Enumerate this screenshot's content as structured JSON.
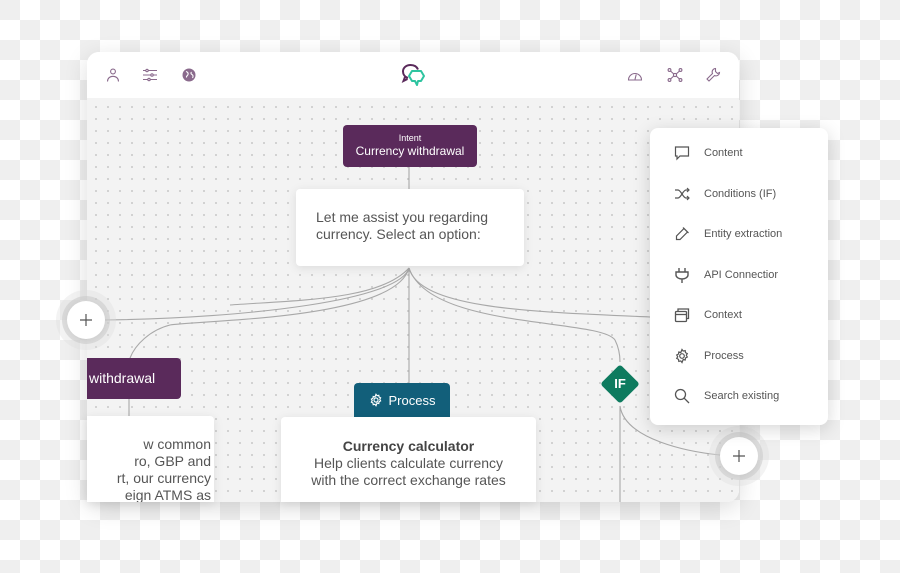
{
  "toolbar": {
    "left_icons": [
      "user-icon",
      "sliders-icon",
      "globe-icon"
    ],
    "logo": "chat-bubbles-logo",
    "right_icons": [
      "gauge-icon",
      "network-icon",
      "wrench-icon"
    ]
  },
  "colors": {
    "intent": "#5a2a5b",
    "process": "#125f7a",
    "condition": "#0e7b5f",
    "logo_primary": "#5a2a5b",
    "logo_secondary": "#2ec4a0"
  },
  "flow": {
    "intent_node": {
      "kind": "Intent",
      "title": "Currency withdrawal"
    },
    "message_node": {
      "lines": [
        "Let me assist you regarding",
        "currency. Select an option:"
      ]
    },
    "left_intent_node": {
      "title": "withdrawal"
    },
    "left_message_node": {
      "lines": [
        "w common",
        "ro, GBP and",
        "rt, our currency",
        "eign ATMS as"
      ]
    },
    "process_node": {
      "label": "Process",
      "title": "Currency calculator",
      "lines": [
        "Help clients calculate currency",
        "with the correct exchange rates"
      ]
    },
    "if_node": {
      "label": "IF"
    },
    "add_buttons": [
      "+",
      "+"
    ]
  },
  "menu": {
    "items": [
      {
        "icon": "comment-icon",
        "label": "Content"
      },
      {
        "icon": "shuffle-icon",
        "label": "Conditions (IF)"
      },
      {
        "icon": "eyedropper-icon",
        "label": "Entity extraction"
      },
      {
        "icon": "plug-icon",
        "label": "API Connectior"
      },
      {
        "icon": "windows-icon",
        "label": "Context"
      },
      {
        "icon": "gear-icon",
        "label": "Process"
      },
      {
        "icon": "search-icon",
        "label": "Search existing"
      }
    ]
  }
}
